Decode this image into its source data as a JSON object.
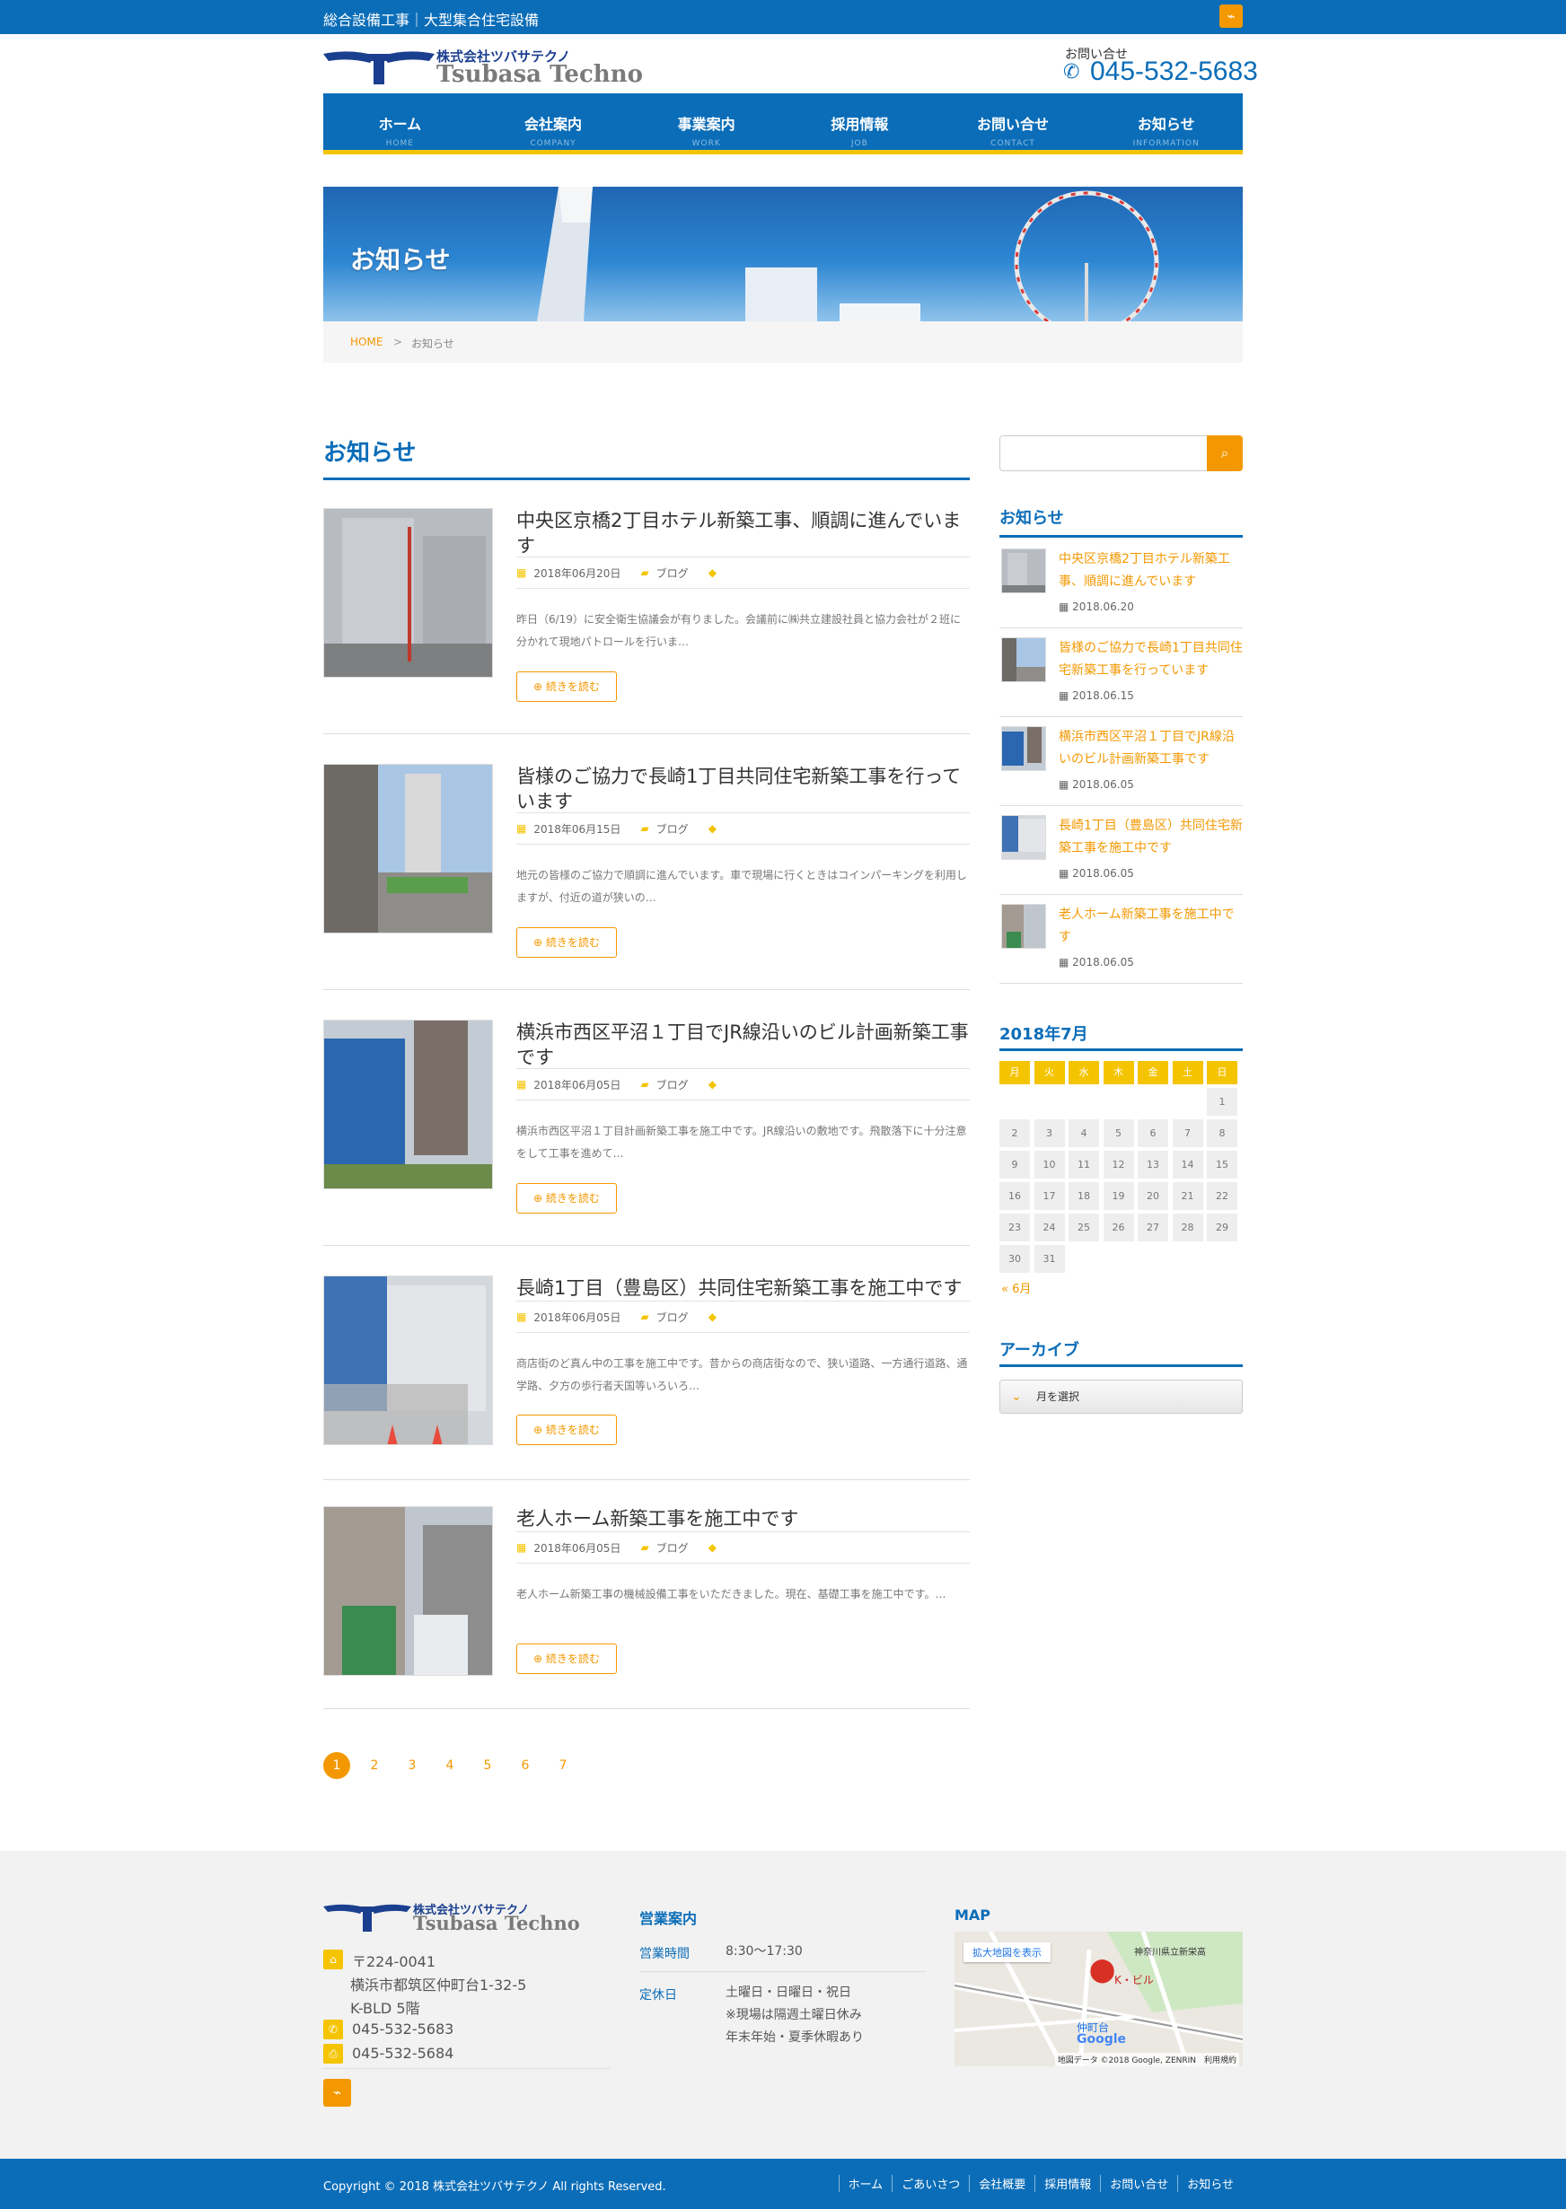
{
  "topbar": {
    "tagline": "総合設備工事｜大型集合住宅設備",
    "rss_icon": "rss-icon"
  },
  "logo": {
    "mark": "T",
    "jp": "株式会社ツバサテクノ",
    "en": "Tsubasa Techno"
  },
  "contact": {
    "label": "お問い合せ",
    "tel": "045-532-5683"
  },
  "nav": [
    {
      "label": "ホーム",
      "sub": "HOME"
    },
    {
      "label": "会社案内",
      "sub": "COMPANY"
    },
    {
      "label": "事業案内",
      "sub": "WORK"
    },
    {
      "label": "採用情報",
      "sub": "JOB"
    },
    {
      "label": "お問い合せ",
      "sub": "CONTACT"
    },
    {
      "label": "お知らせ",
      "sub": "INFORMATION"
    }
  ],
  "hero": {
    "title": "お知らせ"
  },
  "breadcrumb": {
    "home": "HOME",
    "sep": ">",
    "current": "お知らせ"
  },
  "main": {
    "title": "お知らせ"
  },
  "posts": [
    {
      "title": "中央区京橋2丁目ホテル新築工事、順調に進んでいます",
      "date": "2018年06月20日",
      "category": "ブログ",
      "excerpt": "昨日（6/19）に安全衛生協議会が有りました。会議前に㈱共立建設社員と協力会社が２班に分かれて現地パトロールを行いま…",
      "more": "続きを読む"
    },
    {
      "title": "皆様のご協力で長崎1丁目共同住宅新築工事を行っています",
      "date": "2018年06月15日",
      "category": "ブログ",
      "excerpt": "地元の皆様のご協力で順調に進んでいます。車で現場に行くときはコインパーキングを利用しますが、付近の道が狭いの…",
      "more": "続きを読む"
    },
    {
      "title": "横浜市西区平沼１丁目でJR線沿いのビル計画新築工事です",
      "date": "2018年06月05日",
      "category": "ブログ",
      "excerpt": "横浜市西区平沼１丁目計画新築工事を施工中です。JR線沿いの敷地です。飛散落下に十分注意をして工事を進めて…",
      "more": "続きを読む"
    },
    {
      "title": "長崎1丁目（豊島区）共同住宅新築工事を施工中です",
      "date": "2018年06月05日",
      "category": "ブログ",
      "excerpt": "商店街のど真ん中の工事を施工中です。昔からの商店街なので、狭い道路、一方通行道路、通学路、夕方の歩行者天国等いろいろ…",
      "more": "続きを読む"
    },
    {
      "title": "老人ホーム新築工事を施工中です",
      "date": "2018年06月05日",
      "category": "ブログ",
      "excerpt": "老人ホーム新築工事の機械設備工事をいただきました。現在、基礎工事を施工中です。…",
      "more": "続きを読む"
    }
  ],
  "pagination": [
    "1",
    "2",
    "3",
    "4",
    "5",
    "6",
    "7"
  ],
  "sidebar": {
    "news_title": "お知らせ",
    "news": [
      {
        "title": "中央区京橋2丁目ホテル新築工事、順調に進んでいます",
        "date": "2018.06.20"
      },
      {
        "title": "皆様のご協力で長崎1丁目共同住宅新築工事を行っています",
        "date": "2018.06.15"
      },
      {
        "title": "横浜市西区平沼１丁目でJR線沿いのビル計画新築工事です",
        "date": "2018.06.05"
      },
      {
        "title": "長崎1丁目（豊島区）共同住宅新築工事を施工中です",
        "date": "2018.06.05"
      },
      {
        "title": "老人ホーム新築工事を施工中です",
        "date": "2018.06.05"
      }
    ],
    "calendar_title": "2018年7月",
    "weekdays": [
      "月",
      "火",
      "水",
      "木",
      "金",
      "土",
      "日"
    ],
    "calendar_prev": "« 6月",
    "archive_title": "アーカイブ",
    "archive_select": "月を選択"
  },
  "footer": {
    "postal": "〒224-0041",
    "address1": "横浜市都筑区仲町台1-32-5",
    "address2": "K-BLD 5階",
    "tel": "045-532-5683",
    "fax": "045-532-5684",
    "hours_title": "営業案内",
    "hours_label": "営業時間",
    "hours_value": "8:30〜17:30",
    "holiday_label": "定休日",
    "holiday_lines": [
      "土曜日・日曜日・祝日",
      "※現場は隔週土曜日休み",
      "年末年始・夏季休暇あり"
    ],
    "map_title": "MAP",
    "map_enlarge": "拡大地図を表示",
    "map_place": "K・ビル",
    "map_label1": "神奈川県立新栄高",
    "map_label2": "仲町台",
    "map_brand": "Google",
    "map_credit": "地図データ ©2018 Google, ZENRIN　利用規約",
    "copyright": "Copyright © 2018 株式会社ツバサテクノ All rights Reserved.",
    "nav": [
      "ホーム",
      "ごあいさつ",
      "会社概要",
      "採用情報",
      "お問い合せ",
      "お知らせ"
    ]
  },
  "colors": {
    "brand_blue": "#0b6db8",
    "accent_orange": "#f39800",
    "accent_yellow": "#f5c400"
  }
}
